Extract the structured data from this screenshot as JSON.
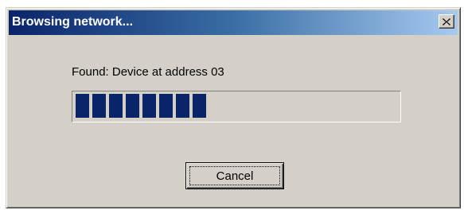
{
  "window": {
    "title": "Browsing network...",
    "close_icon": "close-x-icon"
  },
  "status": {
    "text": "Found: Device at address 03"
  },
  "progress": {
    "segments_filled": 8,
    "fraction": 0.44,
    "color": "#0a246a"
  },
  "buttons": {
    "cancel_label": "Cancel"
  }
}
